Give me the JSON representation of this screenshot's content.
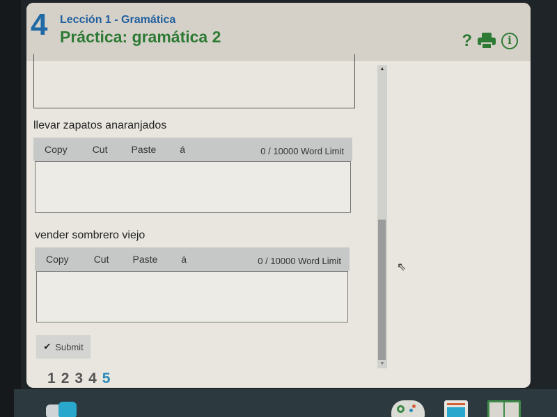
{
  "header": {
    "unit_number": "4",
    "lesson_subtitle": "Lección 1 - Gramática",
    "title": "Práctica: gramática 2",
    "icons": [
      "help-icon",
      "print-icon",
      "info-icon"
    ],
    "help_glyph": "?",
    "info_glyph": "i"
  },
  "questions": [
    {
      "prompt": "llevar zapatos anaranjados",
      "toolbar": {
        "copy": "Copy",
        "cut": "Cut",
        "paste": "Paste",
        "accent": "á"
      },
      "word_count": "0 /  10000 Word Limit",
      "value": ""
    },
    {
      "prompt": "vender sombrero viejo",
      "toolbar": {
        "copy": "Copy",
        "cut": "Cut",
        "paste": "Paste",
        "accent": "á"
      },
      "word_count": "0 /  10000 Word Limit",
      "value": ""
    }
  ],
  "submit": {
    "label": "Submit",
    "icon": "✔"
  },
  "pagination": {
    "pages": [
      "1",
      "2",
      "3",
      "4",
      "5"
    ],
    "current": "5"
  },
  "scrollbar": {
    "up": "▲",
    "down": "▼",
    "position_fraction": 0.95
  },
  "colors": {
    "unit_blue": "#1f6aa5",
    "title_green": "#2d7a35",
    "active_page": "#2a8ab8"
  },
  "dock": [
    "toggle-app",
    "game-controller-app",
    "tablet-app",
    "book-app"
  ]
}
